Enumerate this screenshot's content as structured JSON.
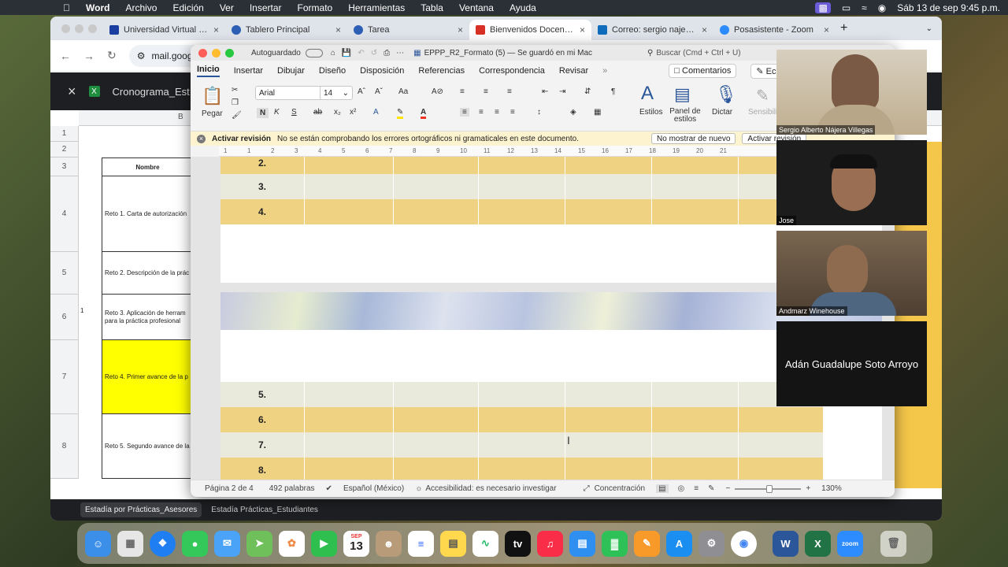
{
  "menubar": {
    "app": "Word",
    "items": [
      "Archivo",
      "Edición",
      "Ver",
      "Insertar",
      "Formato",
      "Herramientas",
      "Tabla",
      "Ventana",
      "Ayuda"
    ],
    "datetime": "Sáb 13 de sep  9:45 p.m."
  },
  "browser": {
    "tabs": [
      {
        "label": "Universidad Virtual del",
        "color": "#1a3fa0"
      },
      {
        "label": "Tablero Principal",
        "color": "#2d5fb5"
      },
      {
        "label": "Tarea",
        "color": "#2d5fb5"
      },
      {
        "label": "Bienvenidos Docentes",
        "color": "#d93025"
      },
      {
        "label": "Correo: sergio najera v",
        "color": "#0f6cbd"
      },
      {
        "label": "Posasistente - Zoom",
        "color": "#2d8cff"
      }
    ],
    "url": "mail.goog"
  },
  "sheets": {
    "title": "Cronograma_Est",
    "col_b": "B",
    "rows": [
      {
        "num": "1",
        "text": ""
      },
      {
        "num": "2",
        "text": ""
      },
      {
        "num": "3",
        "text": "Nombre"
      },
      {
        "num": "4",
        "text": "Reto 1. Carta de autorización"
      },
      {
        "num": "5",
        "text": "Reto 2. Descripción de la prác"
      },
      {
        "num": "6",
        "text": "Reto 3. Aplicación de herram para la práctica profesional"
      },
      {
        "num": "7",
        "text": "Reto 4. Primer avance de la p"
      },
      {
        "num": "8",
        "text": "Reto 5. Segundo avance de la"
      }
    ],
    "left_marker": "1",
    "tabs": [
      "Estadía por Prácticas_Asesores",
      "Estadía Prácticas_Estudiantes"
    ]
  },
  "word": {
    "autosave": "Autoguardado",
    "doc_title": "EPPP_R2_Formato (5) — Se guardó en mi Mac",
    "search": "Buscar (Cmd + Ctrl + U)",
    "menu": [
      "Inicio",
      "Insertar",
      "Dibujar",
      "Diseño",
      "Disposición",
      "Referencias",
      "Correspondencia",
      "Revisar"
    ],
    "comments": "Comentarios",
    "edit": "Ec",
    "paste": "Pegar",
    "font": "Arial",
    "size": "14",
    "styles": "Estilos",
    "styles_pane": "Panel de estilos",
    "dictate": "Dictar",
    "sensitivity": "Sensibili",
    "notice_title": "Activar revisión",
    "notice_text": "No se están comprobando los errores ortográficos ni gramaticales en este documento.",
    "notice_btn1": "No mostrar de nuevo",
    "notice_btn2": "Activar revisión",
    "ruler": [
      "1",
      "1",
      "2",
      "3",
      "4",
      "5",
      "6",
      "7",
      "8",
      "9",
      "10",
      "11",
      "12",
      "13",
      "14",
      "15",
      "16",
      "17",
      "18",
      "19",
      "20",
      "21"
    ],
    "rows_top": [
      "2.",
      "3.",
      "4."
    ],
    "rows_bottom": [
      "5.",
      "6.",
      "7.",
      "8."
    ],
    "status": {
      "page": "Página 2 de 4",
      "words": "492 palabras",
      "lang": "Español (México)",
      "access": "Accesibilidad: es necesario investigar",
      "focus": "Concentración",
      "zoom": "130%"
    }
  },
  "zoom": {
    "participants": [
      "Sergio Alberto Nájera Villegas",
      "Jose",
      "Andmarz Winehouse",
      "Adán Guadalupe Soto Arroyo"
    ]
  },
  "dock": {
    "calendar_month": "SEP",
    "calendar_day": "13"
  }
}
